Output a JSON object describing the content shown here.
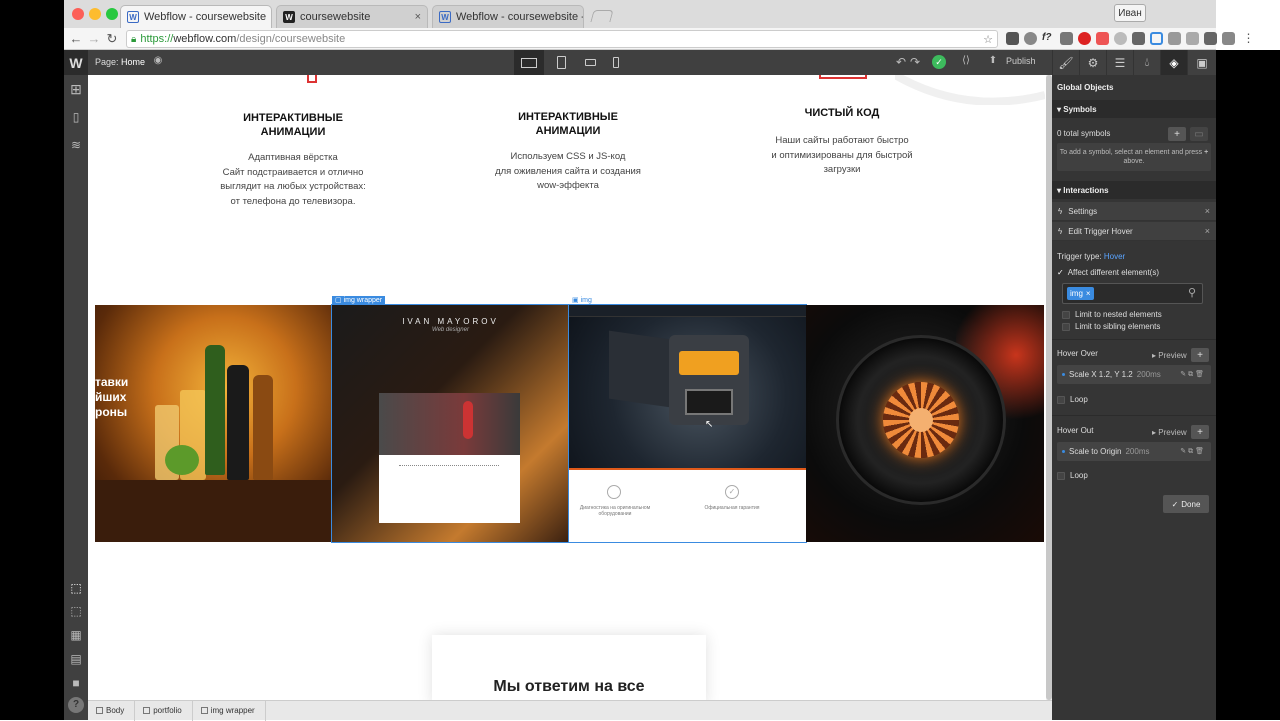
{
  "browser": {
    "tabs": [
      {
        "title": "Webflow - coursewebsite",
        "icon": "webflow-favicon",
        "active": true
      },
      {
        "title": "coursewebsite",
        "icon": "webflow-dark-favicon",
        "active": false
      },
      {
        "title": "Webflow - coursewebsite - Mo",
        "icon": "webflow-favicon",
        "active": false
      }
    ],
    "profile": "Иван",
    "url": {
      "scheme": "https://",
      "domain": "webflow.com",
      "path": "/design/coursewebsite"
    }
  },
  "topbar": {
    "page_label": "Page:",
    "page_name": "Home",
    "publish": "Publish"
  },
  "canvas": {
    "features": [
      {
        "title_line1": "ИНТЕРАКТИВНЫЕ",
        "title_line2": "АНИМАЦИИ",
        "lines": [
          "Адаптивная вёрстка",
          "Сайт подстраивается и отлично",
          "выглядит на любых устройствах:",
          "от телефона до телевизора."
        ]
      },
      {
        "title_line1": "ИНТЕРАКТИВНЫЕ",
        "title_line2": "АНИМАЦИИ",
        "lines": [
          "Используем CSS и JS-код",
          "для оживления сайта и создания",
          "wow-эффекта"
        ]
      },
      {
        "title_line1": "ЧИСТЫЙ КОД",
        "title_line2": "",
        "lines": [
          "Наши сайты работают быстро",
          "и оптимизированы для быстрой",
          "загрузки"
        ]
      }
    ],
    "img_wrapper_label": "img wrapper",
    "img_label": "img",
    "portfolio_texts": {
      "ivan_logo": "IVAN MAYOROV",
      "ivan_sub": "Web designer",
      "beer_text": [
        "тавки",
        "йших",
        "роны"
      ],
      "truck_caption1": "Диагностика на оригинальном оборудовании",
      "truck_caption2": "Официальная гарантия"
    },
    "card_heading": "Мы ответим на все"
  },
  "breadcrumbs": [
    "Body",
    "portfolio",
    "img wrapper"
  ],
  "panel": {
    "global_objects": "Global Objects",
    "symbols_header": "Symbols",
    "total_symbols": "0 total symbols",
    "symbols_hint": "To add a symbol, select an element and press",
    "symbols_hint_end": "above.",
    "interactions_header": "Interactions",
    "settings": "Settings",
    "edit_trigger": "Edit Trigger Hover",
    "trigger_type_label": "Trigger type:",
    "trigger_type_value": "Hover",
    "affect_different": "Affect different element(s)",
    "selector_tag": "img",
    "limit_nested": "Limit to nested elements",
    "limit_sibling": "Limit to sibling elements",
    "hover_over": "Hover Over",
    "preview": "Preview",
    "hover_over_effect": "Scale X 1.2, Y 1.2",
    "hover_over_duration": "200ms",
    "loop": "Loop",
    "hover_out": "Hover Out",
    "hover_out_effect": "Scale to Origin",
    "hover_out_duration": "200ms",
    "done": "Done"
  },
  "colors": {
    "accent": "#3a8be0",
    "panel_bg": "#353535",
    "toolbar_bg": "#404040",
    "red_icon": "#dd3333"
  }
}
